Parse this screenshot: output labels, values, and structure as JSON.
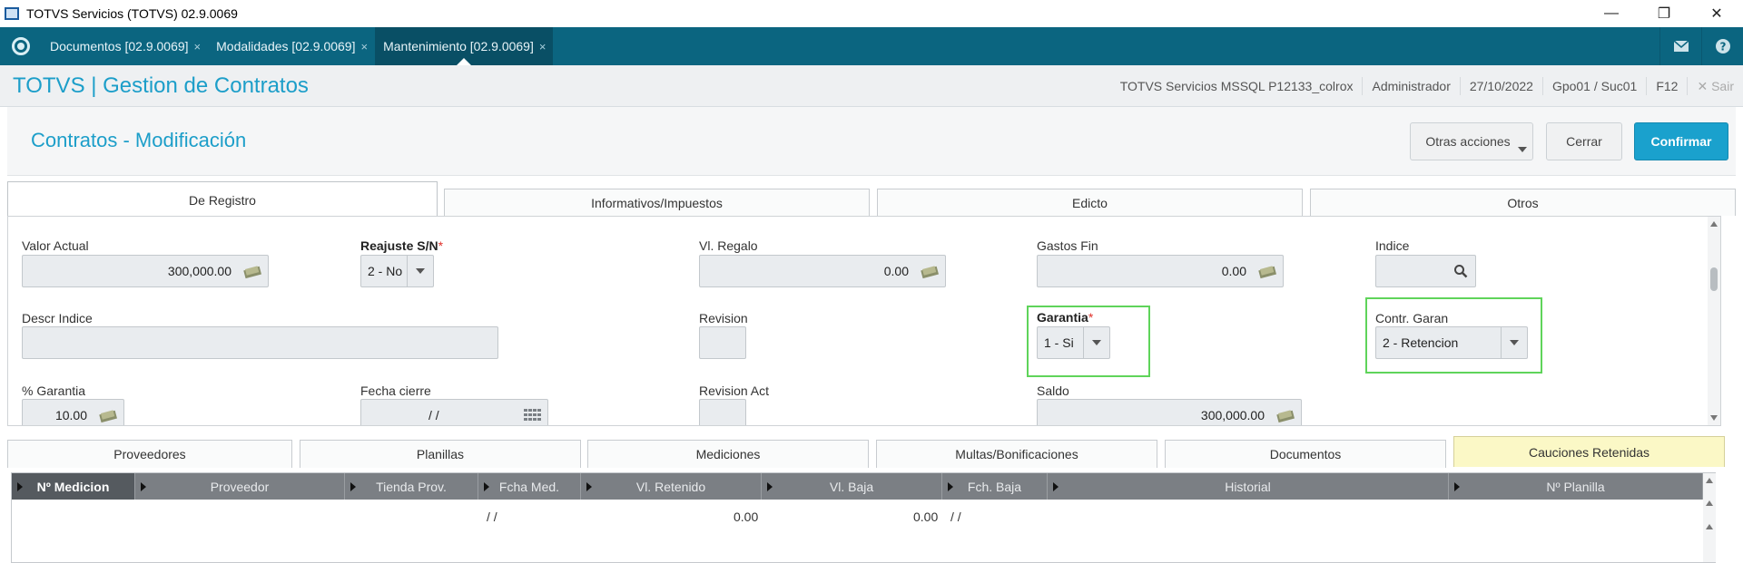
{
  "window": {
    "title": "TOTVS Servicios (TOTVS) 02.9.0069",
    "controls": [
      "—",
      "❐",
      "✕"
    ]
  },
  "tabs": [
    {
      "label": "Documentos [02.9.0069]",
      "close": "×"
    },
    {
      "label": "Modalidades [02.9.0069]",
      "close": "×"
    },
    {
      "label": "Mantenimiento [02.9.0069]",
      "close": "×"
    }
  ],
  "header": {
    "app_title": "TOTVS | Gestion de Contratos",
    "environment": "TOTVS Servicios MSSQL P12133_colrox",
    "user": "Administrador",
    "date": "27/10/2022",
    "branch": "Gpo01 / Suc01",
    "help_key": "F12",
    "exit_label": "✕  Sair"
  },
  "page": {
    "title": "Contratos - Modificación",
    "other_actions_label": "Otras acciones",
    "close_label": "Cerrar",
    "confirm_label": "Confirmar"
  },
  "form_tabs": [
    "De Registro",
    "Informativos/Impuestos",
    "Edicto",
    "Otros"
  ],
  "fields": {
    "valor_actual": {
      "label": "Valor Actual",
      "value": "300,000.00"
    },
    "reajuste": {
      "label": "Reajuste S/N",
      "value": "2 - No"
    },
    "vl_regalo": {
      "label": "Vl. Regalo",
      "value": "0.00"
    },
    "gastos_fin": {
      "label": "Gastos Fin",
      "value": "0.00"
    },
    "indice": {
      "label": "Indice",
      "value": ""
    },
    "descr_indice": {
      "label": "Descr Indice",
      "value": ""
    },
    "revision": {
      "label": "Revision",
      "value": ""
    },
    "garantia": {
      "label": "Garantia",
      "value": "1 - Si"
    },
    "contr_garan": {
      "label": "Contr. Garan",
      "value": "2 - Retencion"
    },
    "pct_garantia": {
      "label": "% Garantia",
      "value": "10.00"
    },
    "fecha_cierre": {
      "label": "Fecha cierre",
      "value": "/  /"
    },
    "revision_act": {
      "label": "Revision Act",
      "value": ""
    },
    "saldo": {
      "label": "Saldo",
      "value": "300,000.00"
    }
  },
  "bottom_tabs": [
    "Proveedores",
    "Planillas",
    "Mediciones",
    "Multas/Bonificaciones",
    "Documentos",
    "Cauciones Retenidas"
  ],
  "grid": {
    "columns": [
      "Nº Medicion",
      "Proveedor",
      "Tienda Prov.",
      "Fcha Med.",
      "Vl. Retenido",
      "Vl. Baja",
      "Fch. Baja",
      "Historial",
      "Nº Planilla"
    ],
    "rows": [
      {
        "fcha_med": "/  /",
        "vl_retenido": "0.00",
        "vl_baja": "0.00",
        "fch_baja": "/  /"
      }
    ]
  },
  "colors": {
    "tabbar": "#0b6580",
    "accent": "#1c9ec9",
    "confirm": "#1aa1cd",
    "highlight": "#5fd45a",
    "active_bottom_tab": "#fbf8c6"
  }
}
